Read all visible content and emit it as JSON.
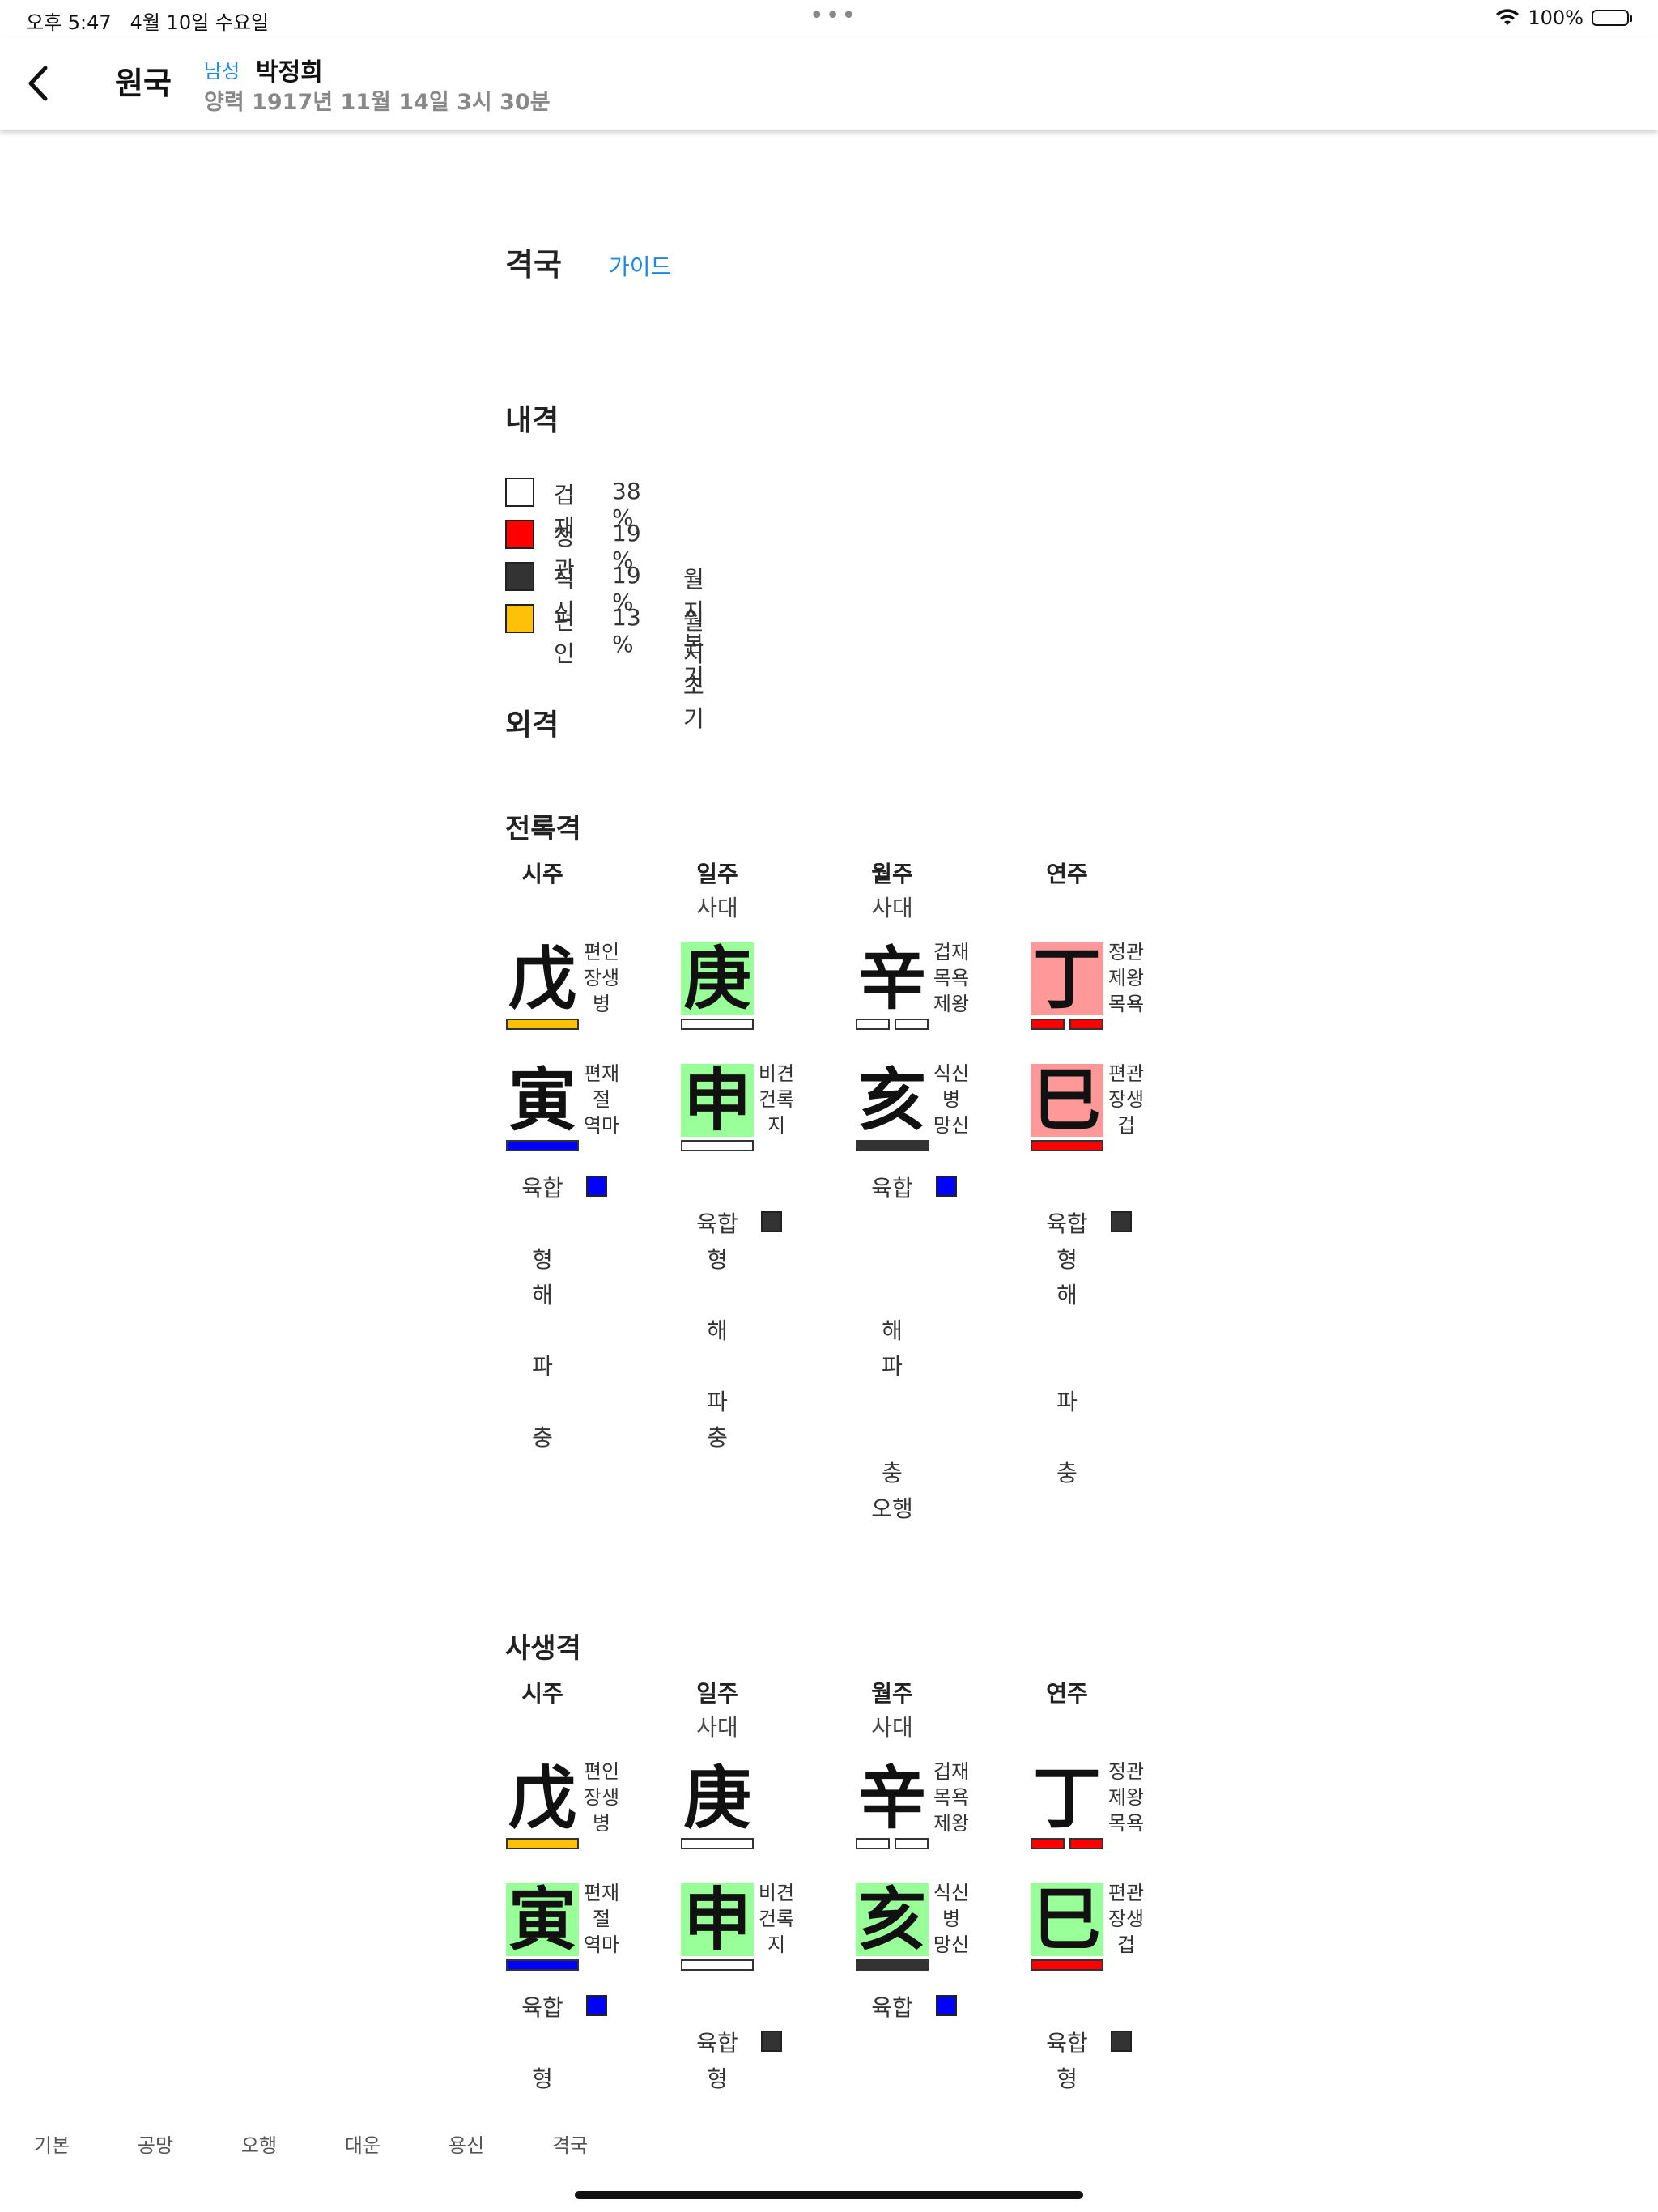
{
  "status_bar": {
    "time": "오후 5:47",
    "date": "4월 10일 수요일",
    "battery": "100%"
  },
  "header": {
    "title": "원국",
    "gender": "남성",
    "name": "박정희",
    "birth": "양력 1917년 11월 14일 3시 30분"
  },
  "page": {
    "title": "격국",
    "guide_link": "가이드"
  },
  "inner": {
    "title": "내격",
    "items": [
      {
        "label": "겁재",
        "pct": "38 %",
        "note": "",
        "color": "#ffffff"
      },
      {
        "label": "정관",
        "pct": "19 %",
        "note": "",
        "color": "#ff0000"
      },
      {
        "label": "식신",
        "pct": "19 %",
        "note": "월지 본기",
        "color": "#333333"
      },
      {
        "label": "편인",
        "pct": "13 %",
        "note": "월지 초기",
        "color": "#ffc107"
      }
    ]
  },
  "outer": {
    "title": "외격",
    "sections": [
      {
        "title": "전록격",
        "pillars": [
          {
            "head": "시주",
            "sub": "",
            "stem": {
              "char": "戊",
              "bg": "",
              "tags": [
                "편인",
                "장생",
                "병"
              ],
              "bar": [
                "#ffc107"
              ]
            },
            "branch": {
              "char": "寅",
              "bg": "",
              "tags": [
                "편재",
                "절",
                "역마"
              ],
              "bar": [
                "#0000ff"
              ]
            },
            "relations": [
              {
                "text": "육합",
                "sw": "#0000ff",
                "row": 0
              },
              {
                "text": "형",
                "row": 2
              },
              {
                "text": "해",
                "row": 3
              },
              {
                "text": "파",
                "row": 5
              },
              {
                "text": "충",
                "row": 7
              }
            ]
          },
          {
            "head": "일주",
            "sub": "사대",
            "stem": {
              "char": "庚",
              "bg": "#99ff99",
              "tags": [
                "",
                ""
              ],
              "bar": [
                "#ffffff"
              ]
            },
            "branch": {
              "char": "申",
              "bg": "#99ff99",
              "tags": [
                "비견",
                "건록",
                "지"
              ],
              "bar": [
                "#ffffff"
              ]
            },
            "relations": [
              {
                "text": "육합",
                "sw": "#333333",
                "row": 1
              },
              {
                "text": "형",
                "row": 2
              },
              {
                "text": "해",
                "row": 4
              },
              {
                "text": "파",
                "row": 6
              },
              {
                "text": "충",
                "row": 7
              }
            ]
          },
          {
            "head": "월주",
            "sub": "사대",
            "stem": {
              "char": "辛",
              "bg": "",
              "tags": [
                "겁재",
                "목욕",
                "제왕"
              ],
              "bar": [
                "#ffffff",
                "#ffffff"
              ]
            },
            "branch": {
              "char": "亥",
              "bg": "",
              "tags": [
                "식신",
                "병",
                "망신"
              ],
              "bar": [
                "#333333"
              ]
            },
            "relations": [
              {
                "text": "육합",
                "sw": "#0000ff",
                "row": 0
              },
              {
                "text": "해",
                "row": 4
              },
              {
                "text": "파",
                "row": 5
              },
              {
                "text": "충",
                "row": 8
              },
              {
                "text": "오행",
                "row": 9
              }
            ]
          },
          {
            "head": "연주",
            "sub": "",
            "stem": {
              "char": "丁",
              "bg": "#ff9999",
              "tags": [
                "정관",
                "제왕",
                "목욕"
              ],
              "bar": [
                "#ff0000",
                "#ff0000"
              ]
            },
            "branch": {
              "char": "巳",
              "bg": "#ff9999",
              "tags": [
                "편관",
                "장생",
                "겁"
              ],
              "bar": [
                "#ff0000"
              ]
            },
            "relations": [
              {
                "text": "육합",
                "sw": "#333333",
                "row": 1
              },
              {
                "text": "형",
                "row": 2
              },
              {
                "text": "해",
                "row": 3
              },
              {
                "text": "파",
                "row": 6
              },
              {
                "text": "충",
                "row": 8
              }
            ]
          }
        ]
      },
      {
        "title": "사생격",
        "pillars": [
          {
            "head": "시주",
            "sub": "",
            "stem": {
              "char": "戊",
              "bg": "",
              "tags": [
                "편인",
                "장생",
                "병"
              ],
              "bar": [
                "#ffc107"
              ]
            },
            "branch": {
              "char": "寅",
              "bg": "#99ff99",
              "tags": [
                "편재",
                "절",
                "역마"
              ],
              "bar": [
                "#0000ff"
              ]
            },
            "relations": [
              {
                "text": "육합",
                "sw": "#0000ff",
                "row": 0
              },
              {
                "text": "형",
                "row": 2
              }
            ]
          },
          {
            "head": "일주",
            "sub": "사대",
            "stem": {
              "char": "庚",
              "bg": "",
              "tags": [
                "",
                ""
              ],
              "bar": [
                "#ffffff"
              ]
            },
            "branch": {
              "char": "申",
              "bg": "#99ff99",
              "tags": [
                "비견",
                "건록",
                "지"
              ],
              "bar": [
                "#ffffff"
              ]
            },
            "relations": [
              {
                "text": "육합",
                "sw": "#333333",
                "row": 1
              },
              {
                "text": "형",
                "row": 2
              }
            ]
          },
          {
            "head": "월주",
            "sub": "사대",
            "stem": {
              "char": "辛",
              "bg": "",
              "tags": [
                "겁재",
                "목욕",
                "제왕"
              ],
              "bar": [
                "#ffffff",
                "#ffffff"
              ]
            },
            "branch": {
              "char": "亥",
              "bg": "#99ff99",
              "tags": [
                "식신",
                "병",
                "망신"
              ],
              "bar": [
                "#333333"
              ]
            },
            "relations": [
              {
                "text": "육합",
                "sw": "#0000ff",
                "row": 0
              }
            ]
          },
          {
            "head": "연주",
            "sub": "",
            "stem": {
              "char": "丁",
              "bg": "",
              "tags": [
                "정관",
                "제왕",
                "목욕"
              ],
              "bar": [
                "#ff0000",
                "#ff0000"
              ]
            },
            "branch": {
              "char": "巳",
              "bg": "#99ff99",
              "tags": [
                "편관",
                "장생",
                "겁"
              ],
              "bar": [
                "#ff0000"
              ]
            },
            "relations": [
              {
                "text": "육합",
                "sw": "#333333",
                "row": 1
              },
              {
                "text": "형",
                "row": 2
              }
            ]
          }
        ]
      }
    ]
  },
  "tabs": [
    "기본",
    "공망",
    "오행",
    "대운",
    "용신",
    "격국"
  ]
}
